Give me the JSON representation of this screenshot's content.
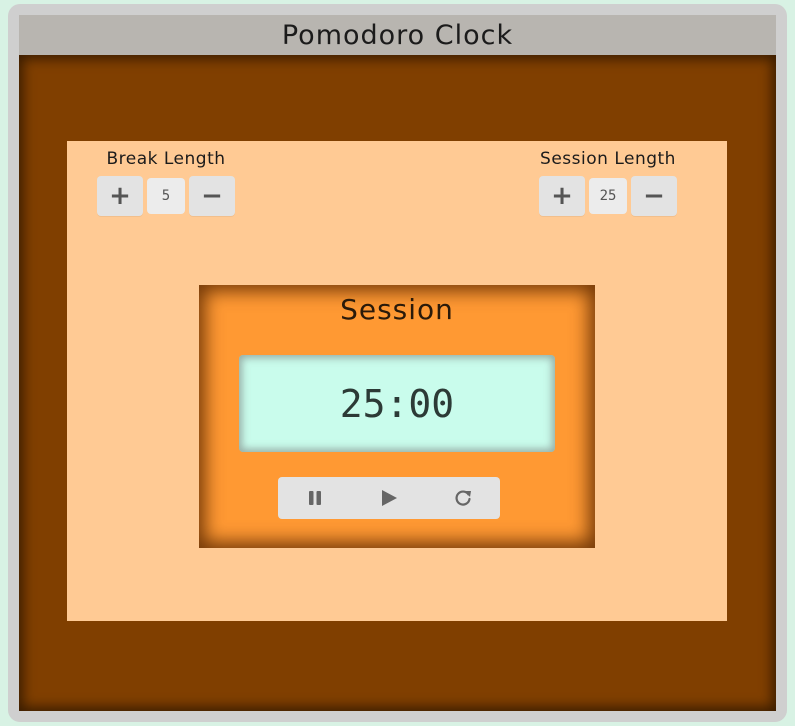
{
  "title": "Pomodoro Clock",
  "break": {
    "label": "Break Length",
    "value": "5",
    "increment": "+",
    "decrement": "−"
  },
  "session": {
    "label": "Session Length",
    "value": "25",
    "increment": "+",
    "decrement": "−"
  },
  "timer": {
    "label": "Session",
    "time": "25:00"
  },
  "icons": {
    "pause": "pause-icon",
    "play": "play-icon",
    "reset": "refresh-icon"
  },
  "colors": {
    "background": "#d8f2e4",
    "stage": "#803f00",
    "panel": "#ffca94",
    "timer": "#ff9933",
    "display": "#c9fcec",
    "button": "#e3e3e3"
  }
}
